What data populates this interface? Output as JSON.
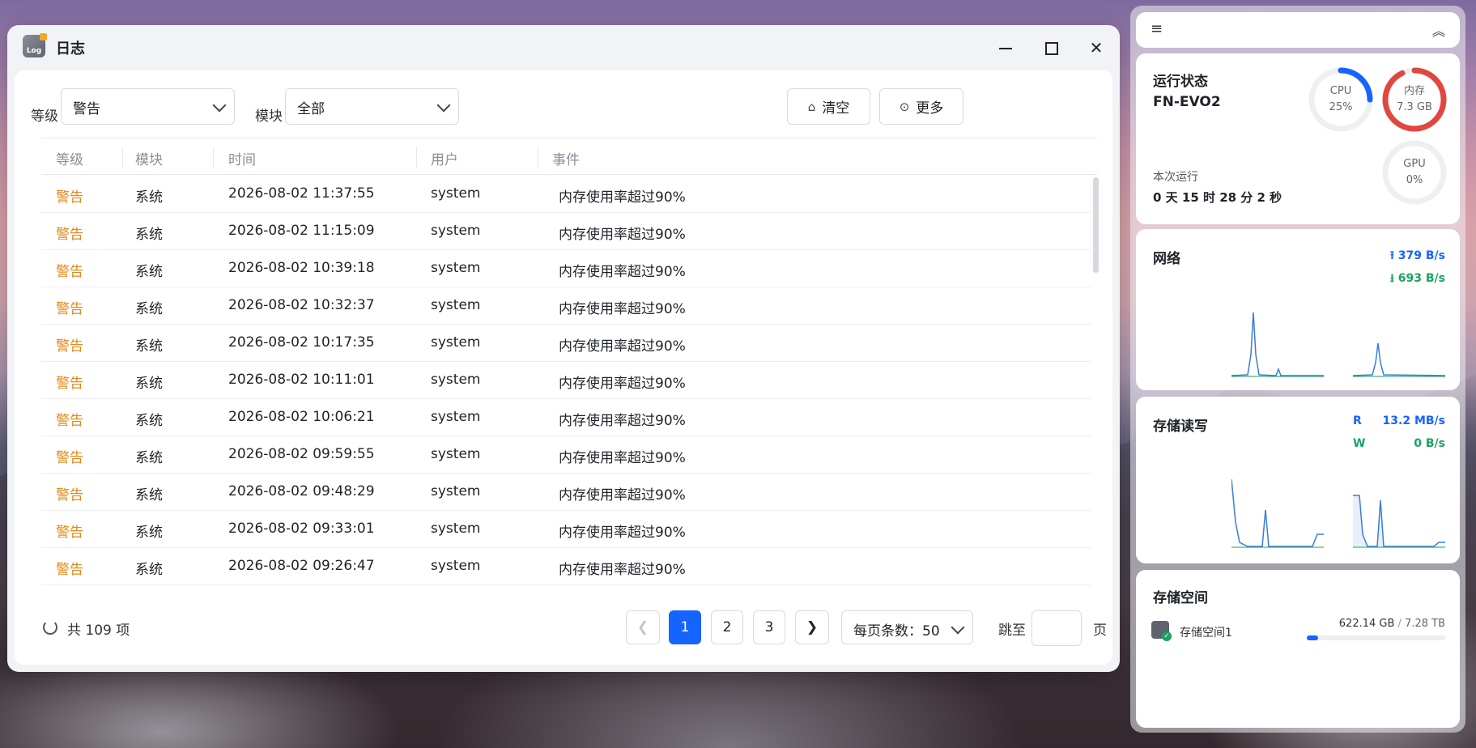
{
  "window": {
    "title": "日志",
    "app_icon_text": "Log"
  },
  "filters": {
    "level_label": "等级",
    "level_value": "警告",
    "module_label": "模块",
    "module_value": "全部",
    "clear_label": "清空",
    "more_label": "更多"
  },
  "table": {
    "columns": [
      "等级",
      "模块",
      "时间",
      "用户",
      "事件"
    ],
    "rows": [
      {
        "level": "警告",
        "module": "系统",
        "time": "2026-08-02 11:37:55",
        "user": "system",
        "event": "内存使用率超过90%"
      },
      {
        "level": "警告",
        "module": "系统",
        "time": "2026-08-02 11:15:09",
        "user": "system",
        "event": "内存使用率超过90%"
      },
      {
        "level": "警告",
        "module": "系统",
        "time": "2026-08-02 10:39:18",
        "user": "system",
        "event": "内存使用率超过90%"
      },
      {
        "level": "警告",
        "module": "系统",
        "time": "2026-08-02 10:32:37",
        "user": "system",
        "event": "内存使用率超过90%"
      },
      {
        "level": "警告",
        "module": "系统",
        "time": "2026-08-02 10:17:35",
        "user": "system",
        "event": "内存使用率超过90%"
      },
      {
        "level": "警告",
        "module": "系统",
        "time": "2026-08-02 10:11:01",
        "user": "system",
        "event": "内存使用率超过90%"
      },
      {
        "level": "警告",
        "module": "系统",
        "time": "2026-08-02 10:06:21",
        "user": "system",
        "event": "内存使用率超过90%"
      },
      {
        "level": "警告",
        "module": "系统",
        "time": "2026-08-02 09:59:55",
        "user": "system",
        "event": "内存使用率超过90%"
      },
      {
        "level": "警告",
        "module": "系统",
        "time": "2026-08-02 09:48:29",
        "user": "system",
        "event": "内存使用率超过90%"
      },
      {
        "level": "警告",
        "module": "系统",
        "time": "2026-08-02 09:33:01",
        "user": "system",
        "event": "内存使用率超过90%"
      },
      {
        "level": "警告",
        "module": "系统",
        "time": "2026-08-02 09:26:47",
        "user": "system",
        "event": "内存使用率超过90%"
      }
    ]
  },
  "pagination": {
    "total": "共 109 项",
    "pages": [
      "1",
      "2",
      "3"
    ],
    "current": "1",
    "page_size": "每页条数：50",
    "jump_label": "跳至",
    "page_unit": "页"
  },
  "widgets": {
    "status": {
      "title": "运行状态",
      "host": "FN-EVO2",
      "cpu_label": "CPU",
      "cpu_value": "25%",
      "cpu_fraction": 0.25,
      "mem_label": "内存",
      "mem_value": "7.3 GB",
      "mem_fraction": 0.93,
      "gpu_label": "GPU",
      "gpu_value": "0%",
      "gpu_fraction": 0,
      "uptime_label": "本次运行",
      "uptime_value": "0 天 15 时 28 分 2 秒"
    },
    "network": {
      "title": "网络",
      "upload": "379 B/s",
      "download": "693 B/s"
    },
    "disk_io": {
      "title": "存储读写",
      "read_label": "R",
      "read": "13.2 MB/s",
      "write_label": "W",
      "write": "0 B/s"
    },
    "storage": {
      "title": "存储空间",
      "name": "存储空间1",
      "used": "622.14 GB",
      "total": "7.28 TB",
      "fraction": 0.083
    }
  },
  "colors": {
    "accent": "#1664ff",
    "warning": "#e08a1e",
    "memory_ring": "#e0473f",
    "green": "#1aa260"
  }
}
